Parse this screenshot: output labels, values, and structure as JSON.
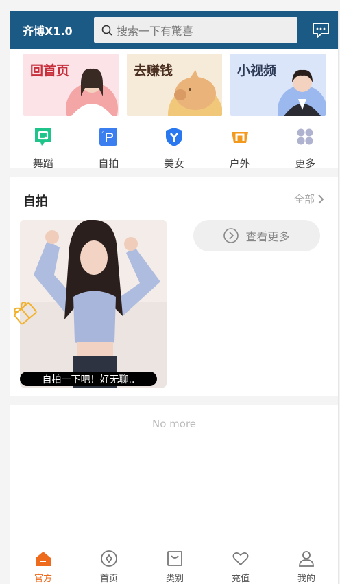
{
  "header": {
    "brand": "齐博X1.0",
    "search_placeholder": "搜索一下有驚喜"
  },
  "banners": [
    {
      "title": "回首页"
    },
    {
      "title": "去赚钱"
    },
    {
      "title": "小视频"
    }
  ],
  "categories": [
    {
      "label": "舞蹈",
      "icon": "q-icon",
      "color": "#1ec48a"
    },
    {
      "label": "自拍",
      "icon": "p-icon",
      "color": "#3a7ef0"
    },
    {
      "label": "美女",
      "icon": "shield-y-icon",
      "color": "#2a78f0"
    },
    {
      "label": "户外",
      "icon": "n-icon",
      "color": "#f39a1e"
    },
    {
      "label": "更多",
      "icon": "grid-icon",
      "color": "#a6a6c8"
    }
  ],
  "section": {
    "title": "自拍",
    "all_label": "全部",
    "thumb_caption": "自拍一下吧！好无聊..",
    "more_label": "查看更多"
  },
  "footer_note": "No more",
  "tabbar": [
    {
      "label": "官方",
      "icon": "home-filled-icon",
      "active": true
    },
    {
      "label": "首页",
      "icon": "compass-icon",
      "active": false
    },
    {
      "label": "类别",
      "icon": "bag-icon",
      "active": false
    },
    {
      "label": "充值",
      "icon": "heart-icon",
      "active": false
    },
    {
      "label": "我的",
      "icon": "user-icon",
      "active": false
    }
  ],
  "colors": {
    "header_bg": "#1c5a86",
    "accent": "#ee6a1c"
  }
}
